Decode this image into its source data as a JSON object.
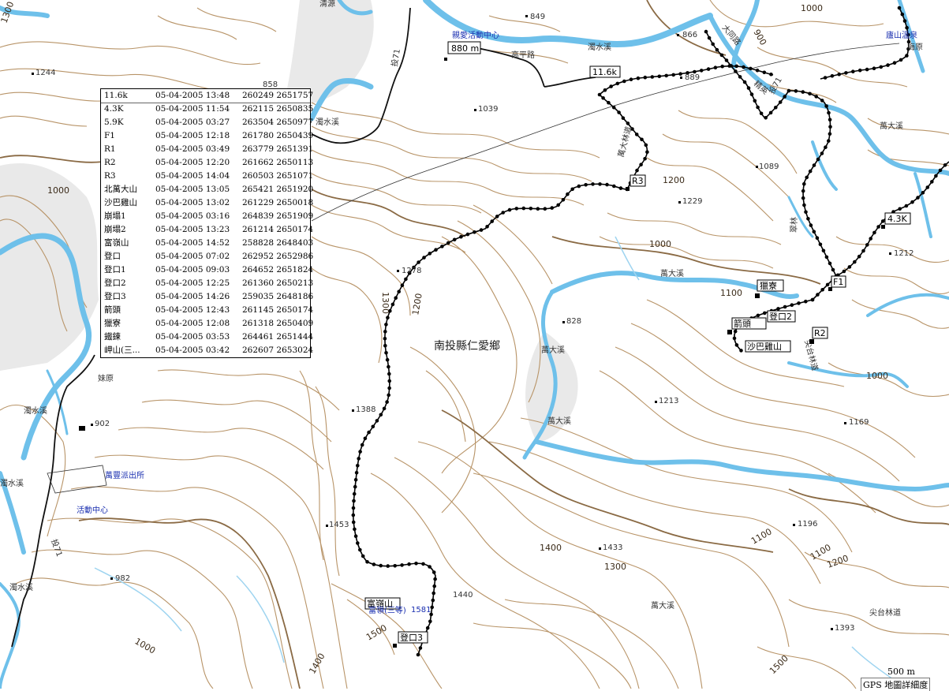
{
  "map": {
    "colors": {
      "background": "#ffffff",
      "contour": "#b89468",
      "contour_index": "#8a6a44",
      "river": "#6ec0ea",
      "track": "#000000",
      "road": "#000000"
    },
    "elevation_labels": [
      "1300",
      "1244",
      "858",
      "1039",
      "1000",
      "849",
      "866",
      "889",
      "1000",
      "900",
      "1229",
      "1089",
      "1200",
      "1000",
      "1278",
      "1300",
      "1200",
      "1212",
      "1100",
      "828",
      "1388",
      "1213",
      "1169",
      "1000",
      "902",
      "1453",
      "1400",
      "1433",
      "1300",
      "1100",
      "1196",
      "1100",
      "1200",
      "982",
      "1440",
      "1581",
      "1500",
      "1000",
      "1400",
      "1393",
      "1500"
    ],
    "place_labels": {
      "township": "南投縣仁愛鄉",
      "stream_1": "濁水溪",
      "stream_2": "濁水溪",
      "stream_3": "濁水溪",
      "stream_4": "濁水溪",
      "stream_5": "濁水溪",
      "wan_da_1": "萬大溪",
      "wan_da_2": "萬大溪",
      "wan_da_3": "萬大溪",
      "wan_da_4": "萬大溪",
      "wan_da_5": "萬大溪",
      "gao_ping": "高平路",
      "mei_yuan": "梅原",
      "mei_yuan_2": "妹原",
      "tai_14": "投71",
      "tai_14b": "投71",
      "tai_14c": "投71",
      "da_tong": "大同路",
      "lin_dao": "尖台林道",
      "lin_dao_2": "尖台林道",
      "forest_station": "萬豐派出所",
      "activity_center": "活動中心",
      "activity_center_2": "親愛活動中心",
      "lu_shan": "廬山溫泉",
      "ching_yuan": "清源",
      "ren_ai": "萬大林道",
      "zuo_lin": "翠林",
      "jing_tou": "精英"
    },
    "waypoint_boxes": {
      "b880": "880 m",
      "b116": "11.6k",
      "b43": "4.3K",
      "br3": "R3",
      "bf1": "F1",
      "br2": "R2",
      "blie": "獵寮",
      "bdeng2": "登口2",
      "bshaba": "沙巴雞山",
      "bfu": "富嶺山",
      "bdeng3": "登口3",
      "bjiantou": "箭頭",
      "bfuhao": "富嶺(三等)"
    },
    "scale_label": "500 m",
    "detail_label": "GPS 地圖詳細度"
  },
  "waypoint_list": {
    "rows": [
      {
        "name": "11.6k",
        "date": "05-04-2005 13:48",
        "coords": "260249 2651757"
      },
      {
        "name": "4.3K",
        "date": "05-04-2005 11:54",
        "coords": "262115 2650835"
      },
      {
        "name": "5.9K",
        "date": "05-04-2005 03:27",
        "coords": "263504 2650977"
      },
      {
        "name": "F1",
        "date": "05-04-2005 12:18",
        "coords": "261780 2650439"
      },
      {
        "name": "R1",
        "date": "05-04-2005 03:49",
        "coords": "263779 2651391"
      },
      {
        "name": "R2",
        "date": "05-04-2005 12:20",
        "coords": "261662 2650113"
      },
      {
        "name": "R3",
        "date": "05-04-2005 14:04",
        "coords": "260503 2651071"
      },
      {
        "name": "北萬大山",
        "date": "05-04-2005 13:05",
        "coords": "265421 2651920"
      },
      {
        "name": "沙巴雞山",
        "date": "05-04-2005 13:02",
        "coords": "261229 2650018"
      },
      {
        "name": "崩塌1",
        "date": "05-04-2005 03:16",
        "coords": "264839 2651909"
      },
      {
        "name": "崩塌2",
        "date": "05-04-2005 13:23",
        "coords": "261214 2650174"
      },
      {
        "name": "富嶺山",
        "date": "05-04-2005 14:52",
        "coords": "258828 2648403"
      },
      {
        "name": "登口",
        "date": "05-04-2005 07:02",
        "coords": "262952 2652986"
      },
      {
        "name": "登口1",
        "date": "05-04-2005 09:03",
        "coords": "264652 2651824"
      },
      {
        "name": "登口2",
        "date": "05-04-2005 12:25",
        "coords": "261360 2650213"
      },
      {
        "name": "登口3",
        "date": "05-04-2005 14:26",
        "coords": "259035 2648186"
      },
      {
        "name": "箭頭",
        "date": "05-04-2005 12:43",
        "coords": "261145 2650174"
      },
      {
        "name": "獵寮",
        "date": "05-04-2005 12:08",
        "coords": "261318 2650409"
      },
      {
        "name": "鐵鍊",
        "date": "05-04-2005 03:53",
        "coords": "264461 2651444"
      },
      {
        "name": "岬山(三...",
        "date": "05-04-2005 03:42",
        "coords": "262607 2653024"
      }
    ]
  }
}
